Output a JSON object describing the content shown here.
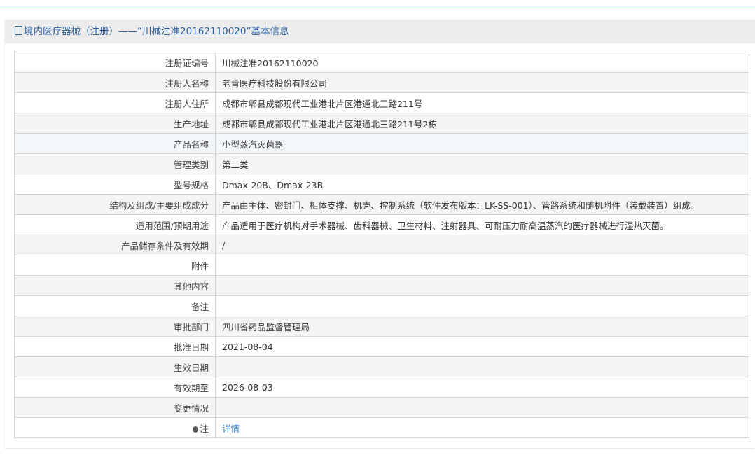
{
  "title": "境内医疗器械（注册）——“川械注准20162110020”基本信息",
  "rows": [
    {
      "label": "注册证编号",
      "value": "川械注准20162110020"
    },
    {
      "label": "注册人名称",
      "value": "老肯医疗科技股份有限公司"
    },
    {
      "label": "注册人住所",
      "value": "成都市郫县成都现代工业港北片区港通北三路211号"
    },
    {
      "label": "生产地址",
      "value": "成都市郫县成都现代工业港北片区港通北三路211号2栋"
    },
    {
      "label": "产品名称",
      "value": "小型蒸汽灭菌器"
    },
    {
      "label": "管理类别",
      "value": "第二类"
    },
    {
      "label": "型号规格",
      "value": "Dmax-20B、Dmax-23B"
    },
    {
      "label": "结构及组成/主要组成成分",
      "value": "产品由主体、密封门、柜体支撑、机壳、控制系统（软件发布版本：LK-SS-001）、管路系统和随机附件（装载装置）组成。"
    },
    {
      "label": "适用范围/预期用途",
      "value": "产品适用于医疗机构对手术器械、齿科器械、卫生材料、注射器具、可耐压力耐高温蒸汽的医疗器械进行湿热灭菌。"
    },
    {
      "label": "产品储存条件及有效期",
      "value": "/"
    },
    {
      "label": "附件",
      "value": ""
    },
    {
      "label": "其他内容",
      "value": ""
    },
    {
      "label": "备注",
      "value": ""
    },
    {
      "label": "审批部门",
      "value": "四川省药品监督管理局"
    },
    {
      "label": "批准日期",
      "value": "2021-08-04"
    },
    {
      "label": "生效日期",
      "value": ""
    },
    {
      "label": "有效期至",
      "value": "2026-08-03"
    },
    {
      "label": "变更情况",
      "value": ""
    }
  ],
  "note": {
    "label": "注",
    "link": "详情"
  }
}
